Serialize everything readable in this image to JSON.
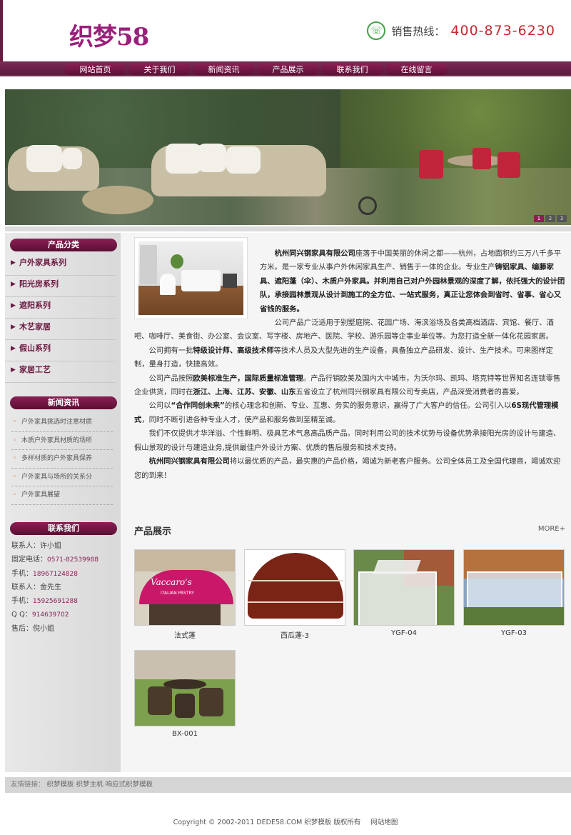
{
  "header": {
    "logo": "织梦58",
    "hotline_label": "销售热线：",
    "hotline_number": "400-873-6230",
    "phone_icon": "phone-circle-icon"
  },
  "nav": {
    "items": [
      {
        "label": "网站首页"
      },
      {
        "label": "关于我们"
      },
      {
        "label": "新闻资讯"
      },
      {
        "label": "产品展示"
      },
      {
        "label": "联系我们"
      },
      {
        "label": "在线留言"
      }
    ]
  },
  "banner": {
    "dots": [
      "1",
      "2",
      "3"
    ]
  },
  "sidebar": {
    "category_title": "产品分类",
    "categories": [
      "户外家具系列",
      "阳光房系列",
      "遮阳系列",
      "木艺家居",
      "假山系列",
      "家居工艺"
    ],
    "news_title": "新闻资讯",
    "news": [
      "户外家具挑选时注意材质",
      "木质户外家具材质的场所",
      "多样材质的户外家具保养",
      "户外家具与场所的关系分",
      "户外家具展望"
    ],
    "contact_title": "联系我们",
    "contact": [
      {
        "label": "联系人：",
        "value": "许小姐",
        "plain": true
      },
      {
        "label": "固定电话：",
        "value": "0571-82539988"
      },
      {
        "label": "手机：",
        "value": "18967124828"
      },
      {
        "label": "联系人：",
        "value": "金先生",
        "plain": true
      },
      {
        "label": "手机：",
        "value": "15925691288"
      },
      {
        "label": "Q Q：",
        "value": "914639702"
      },
      {
        "label": "售后：",
        "value": "倪小姐",
        "plain": true
      }
    ]
  },
  "about": {
    "company": "杭州同兴钢家具有限公司",
    "p1_a": "座落于中国美丽的休闲之都——杭州，占地面积约三万八千多平方米。是一家专业从事户外休闲家具生产、销售于一体的企业。专业生产",
    "p1_b": "铸铝家具、编藤家具、遮阳蓬（伞）、木质户外家具。并利用自己对户外园林景观的深度了解，依托强大的设计团队，承接园林景观从设计到施工的全方位、一站式服务，真正让您体会到省时、省事、省心又省钱的服务。",
    "p2": "公司产品广泛适用于别墅庭院、花园广场、海滨浴场及各类高档酒店、宾馆、餐厅、酒吧、咖啡厅、美食街、办公室、会议室、写字楼、房地产、医院、学校、游乐园等企事业单位等。为您打造全新一体化花园家居。",
    "p3_a": "公司拥有一批",
    "p3_b": "特级设计师、高级技术师",
    "p3_c": "等技术人员及大型先进的生产设备，具备独立产品研发、设计、生产技术。可来图样定制，量身打造，快捷高效。",
    "p4_a": "公司产品按照",
    "p4_b": "欧美标准生产，国际质量标准管理",
    "p4_c": "。产品行销欧美及国内大中城市，为沃尔玛、凯玛、塔克特等世界知名连锁零售企业供货，同时在",
    "p4_d": "浙江、上海、江苏、安徽、山东",
    "p4_e": "五省设立了杭州同兴钢家具有限公司专卖店，产品深受消费者的喜爱。",
    "p5_a": "公司以",
    "p5_b": "“合作同创未来”",
    "p5_c": "的核心理念和创新、专业、互惠、务实的服务意识，赢得了广大客户的信任。公司引入以",
    "p5_d": "6S现代管理模式",
    "p5_e": "，同时不断引进各种专业人才，使产品和服务做到至精至诚。",
    "p6": "我们不仅提供才华洋溢、个性鲜明、极具艺术气息高品质产品。同时利用公司的技术优势与设备优势承接阳光房的设计与建造、假山景观的设计与建造业务,提供最佳户外设计方案、优质的售后服务和技术支持。",
    "p7_b": "杭州同兴钢家具有限公司",
    "p7_c": "将以最优质的产品，最实惠的产品价格，竭诚为新老客户服务。公司全体员工及全国代理商，竭诚欢迎您的到来！"
  },
  "products": {
    "title": "产品展示",
    "more": "MORE+",
    "items": [
      {
        "caption": "法式蓬",
        "sign": "Vaccaro's",
        "sub": "ITALIAN PASTRY"
      },
      {
        "caption": "西瓜蓬-3"
      },
      {
        "caption": "YGF-04"
      },
      {
        "caption": "YGF-03"
      },
      {
        "caption": "BX-001"
      }
    ]
  },
  "links": {
    "label": "友情链接：",
    "items": "织梦模板 织梦主机 响应式织梦模板"
  },
  "footer": {
    "copyright": "Copyright © 2002-2011 DEDE58.COM 织梦模板 版权所有",
    "sitemap": "网站地图"
  },
  "colors": {
    "brand": "#6b1a42",
    "logo": "#9b1f7a",
    "hotline": "#c8262e",
    "phone_icon": "#3fa344"
  }
}
